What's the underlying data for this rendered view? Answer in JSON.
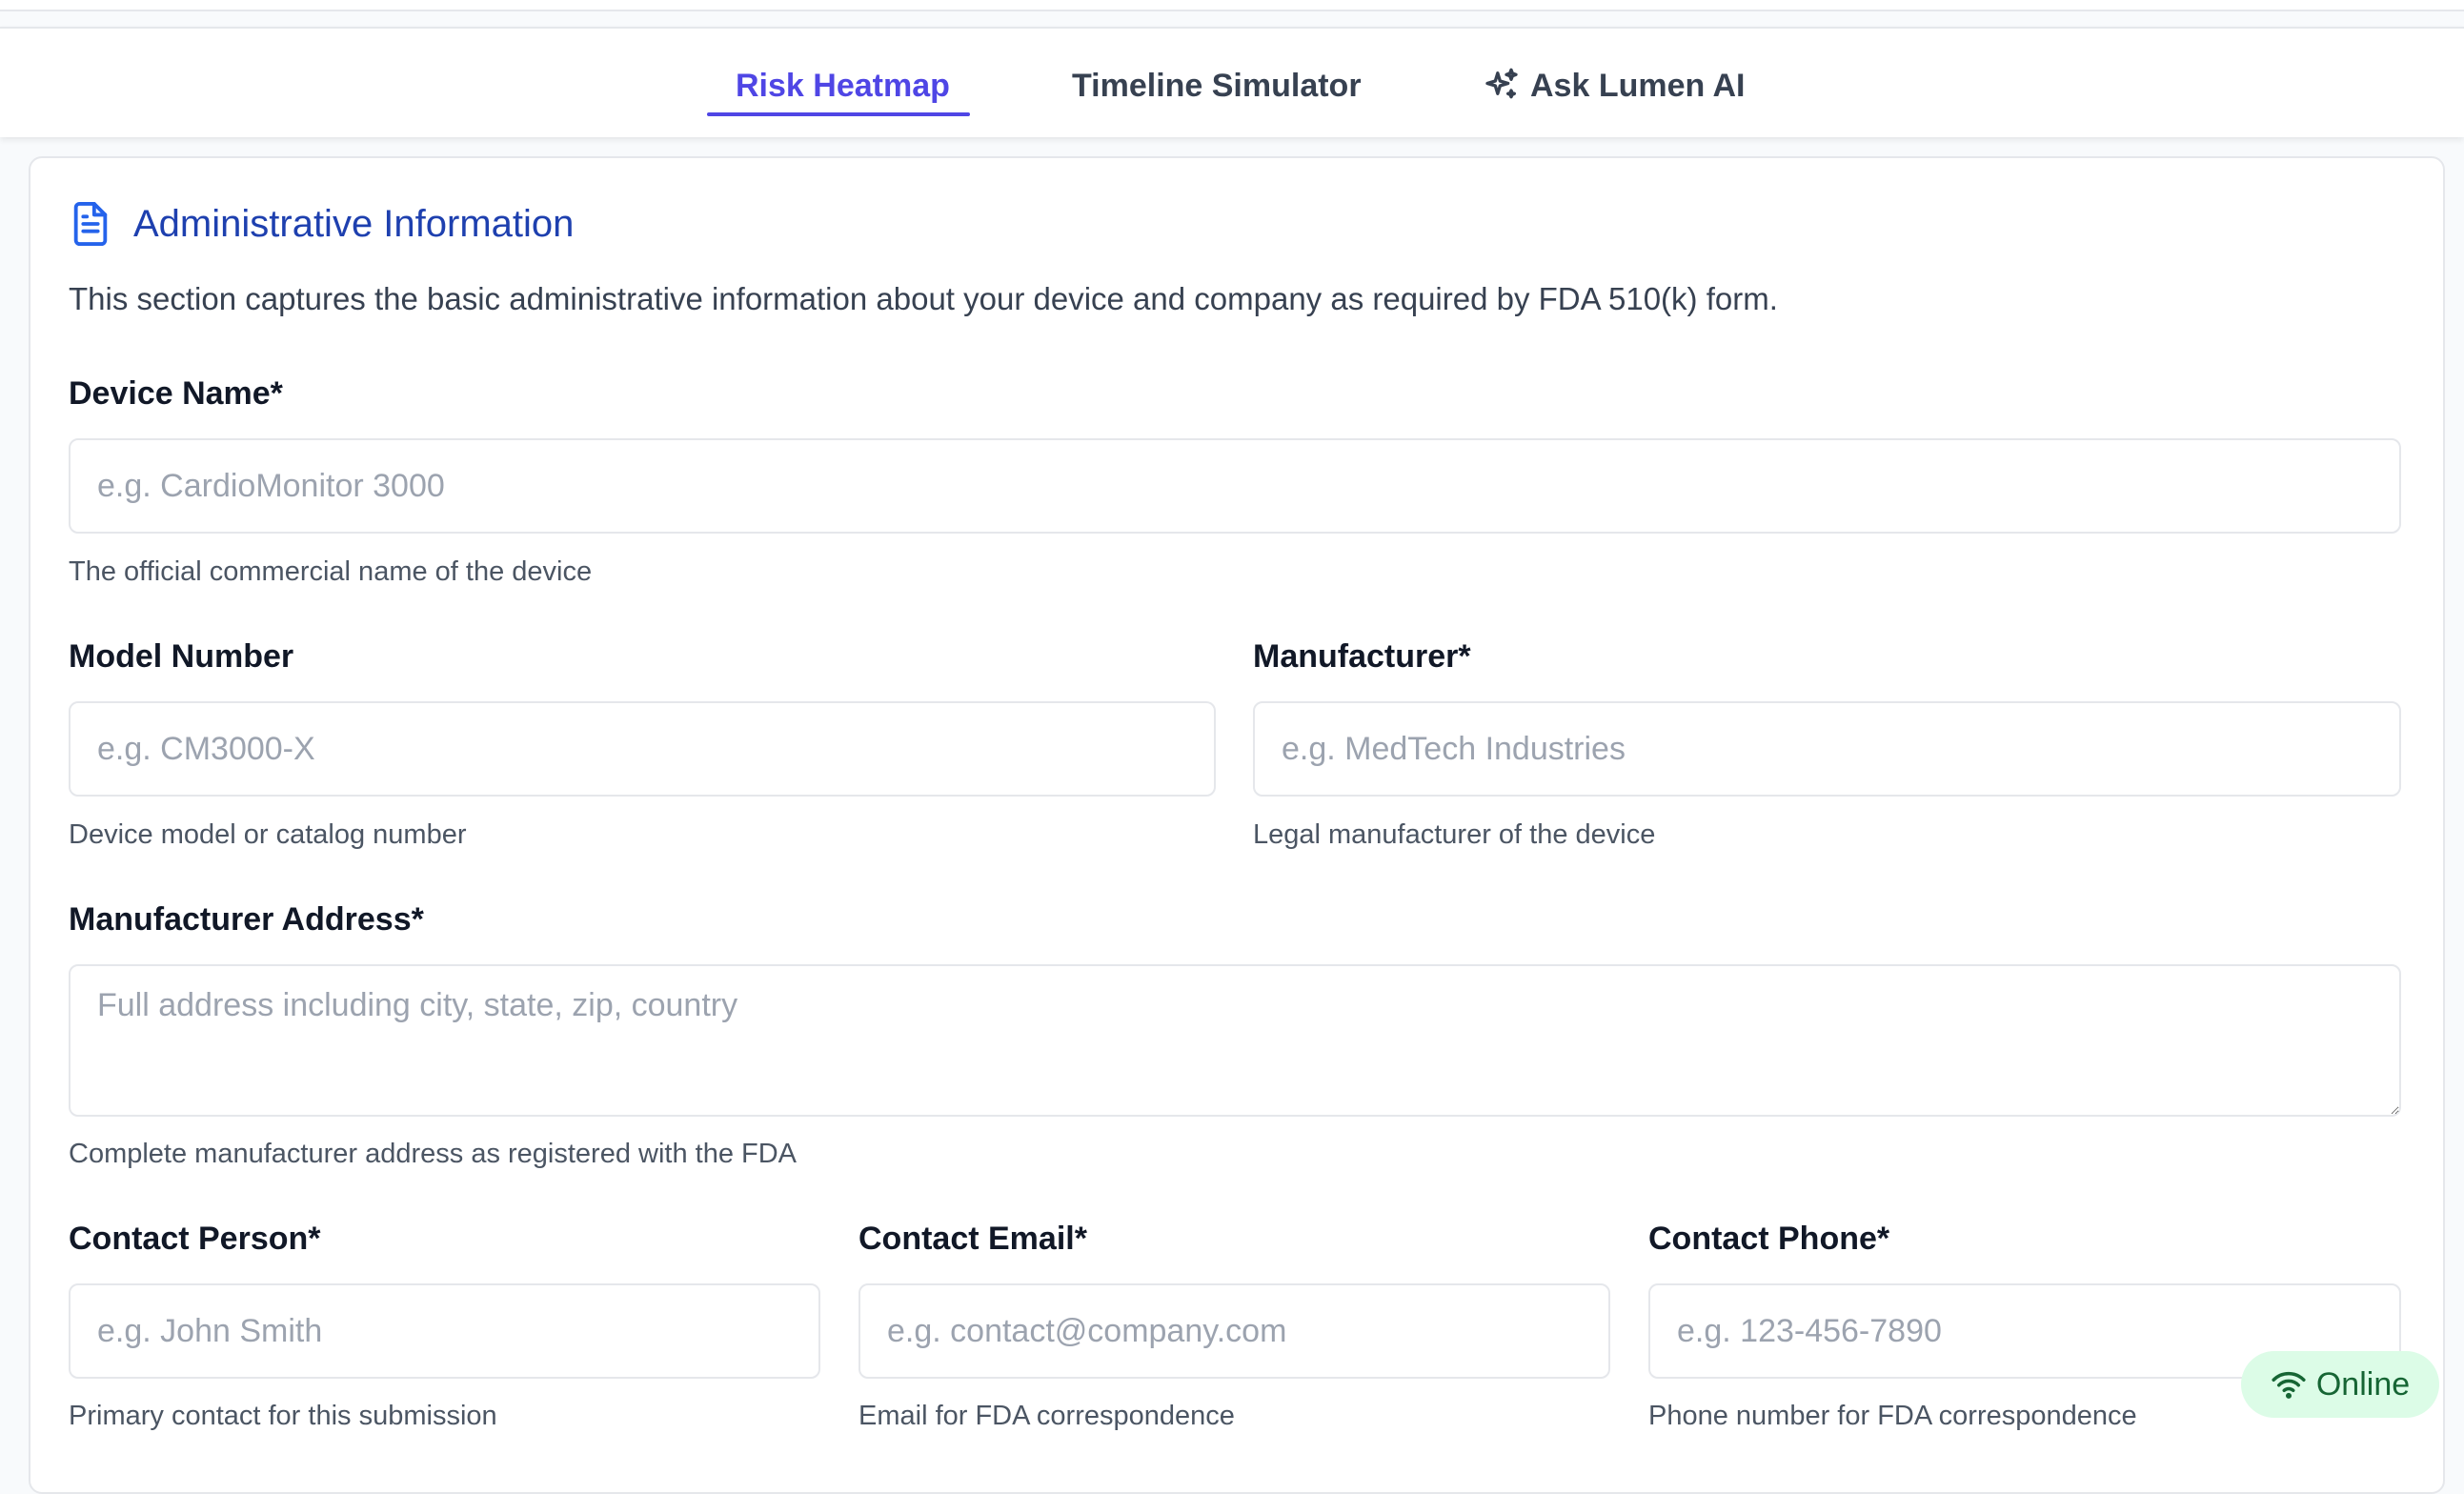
{
  "tabs": [
    {
      "label": "Risk Heatmap",
      "active": true
    },
    {
      "label": "Timeline Simulator",
      "active": false
    },
    {
      "label": "Ask Lumen AI",
      "active": false,
      "icon": "sparkles-icon"
    }
  ],
  "section": {
    "title": "Administrative Information",
    "icon": "document-icon",
    "description": "This section captures the basic administrative information about your device and company as required by FDA 510(k) form."
  },
  "fields": {
    "device_name": {
      "label": "Device Name*",
      "placeholder": "e.g. CardioMonitor 3000",
      "value": "",
      "help": "The official commercial name of the device"
    },
    "model_number": {
      "label": "Model Number",
      "placeholder": "e.g. CM3000-X",
      "value": "",
      "help": "Device model or catalog number"
    },
    "manufacturer": {
      "label": "Manufacturer*",
      "placeholder": "e.g. MedTech Industries",
      "value": "",
      "help": "Legal manufacturer of the device"
    },
    "manufacturer_address": {
      "label": "Manufacturer Address*",
      "placeholder": "Full address including city, state, zip, country",
      "value": "",
      "help": "Complete manufacturer address as registered with the FDA"
    },
    "contact_person": {
      "label": "Contact Person*",
      "placeholder": "e.g. John Smith",
      "value": "",
      "help": "Primary contact for this submission"
    },
    "contact_email": {
      "label": "Contact Email*",
      "placeholder": "e.g. contact@company.com",
      "value": "",
      "help": "Email for FDA correspondence"
    },
    "contact_phone": {
      "label": "Contact Phone*",
      "placeholder": "e.g. 123-456-7890",
      "value": "",
      "help": "Phone number for FDA correspondence"
    }
  },
  "status": {
    "label": "Online",
    "icon": "wifi-icon"
  },
  "colors": {
    "accent": "#4f46e5",
    "section_title": "#1e40af",
    "online_bg": "#dcfce7",
    "online_text": "#166534"
  }
}
